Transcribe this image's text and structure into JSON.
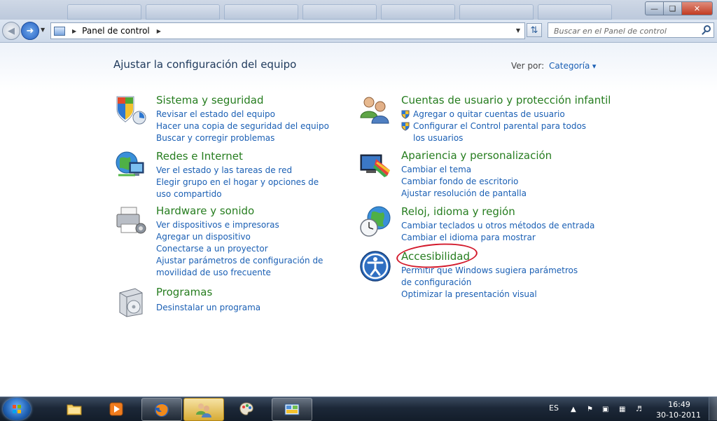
{
  "address_bar": {
    "breadcrumb": "Panel de control",
    "search_placeholder": "Buscar en el Panel de control"
  },
  "main": {
    "heading": "Ajustar la configuración del equipo",
    "view_by_label": "Ver por:",
    "view_by_value": "Categoría",
    "categories": [
      {
        "title": "Sistema y seguridad",
        "links": [
          "Revisar el estado del equipo",
          "Hacer una copia de seguridad del equipo",
          "Buscar y corregir problemas"
        ]
      },
      {
        "title": "Redes e Internet",
        "links": [
          "Ver el estado y las tareas de red",
          "Elegir grupo en el hogar y opciones de uso compartido"
        ]
      },
      {
        "title": "Hardware y sonido",
        "links": [
          "Ver dispositivos e impresoras",
          "Agregar un dispositivo",
          "Conectarse a un proyector",
          "Ajustar parámetros de configuración de movilidad de uso frecuente"
        ]
      },
      {
        "title": "Programas",
        "links": [
          "Desinstalar un programa"
        ]
      },
      {
        "title": "Cuentas de usuario y protección infantil",
        "links": [
          "Agregar o quitar cuentas de usuario",
          "Configurar el Control parental para todos los usuarios"
        ]
      },
      {
        "title": "Apariencia y personalización",
        "links": [
          "Cambiar el tema",
          "Cambiar fondo de escritorio",
          "Ajustar resolución de pantalla"
        ]
      },
      {
        "title": "Reloj, idioma y región",
        "links": [
          "Cambiar teclados u otros métodos de entrada",
          "Cambiar el idioma para mostrar"
        ]
      },
      {
        "title": "Accesibilidad",
        "links": [
          "Permitir que Windows sugiera parámetros de configuración",
          "Optimizar la presentación visual"
        ]
      }
    ]
  },
  "taskbar": {
    "language": "ES",
    "time": "16:49",
    "date": "30-10-2011"
  },
  "colors": {
    "category_title": "#267d1f",
    "link": "#1a5fb4",
    "annotation_circle": "#d3192b"
  }
}
